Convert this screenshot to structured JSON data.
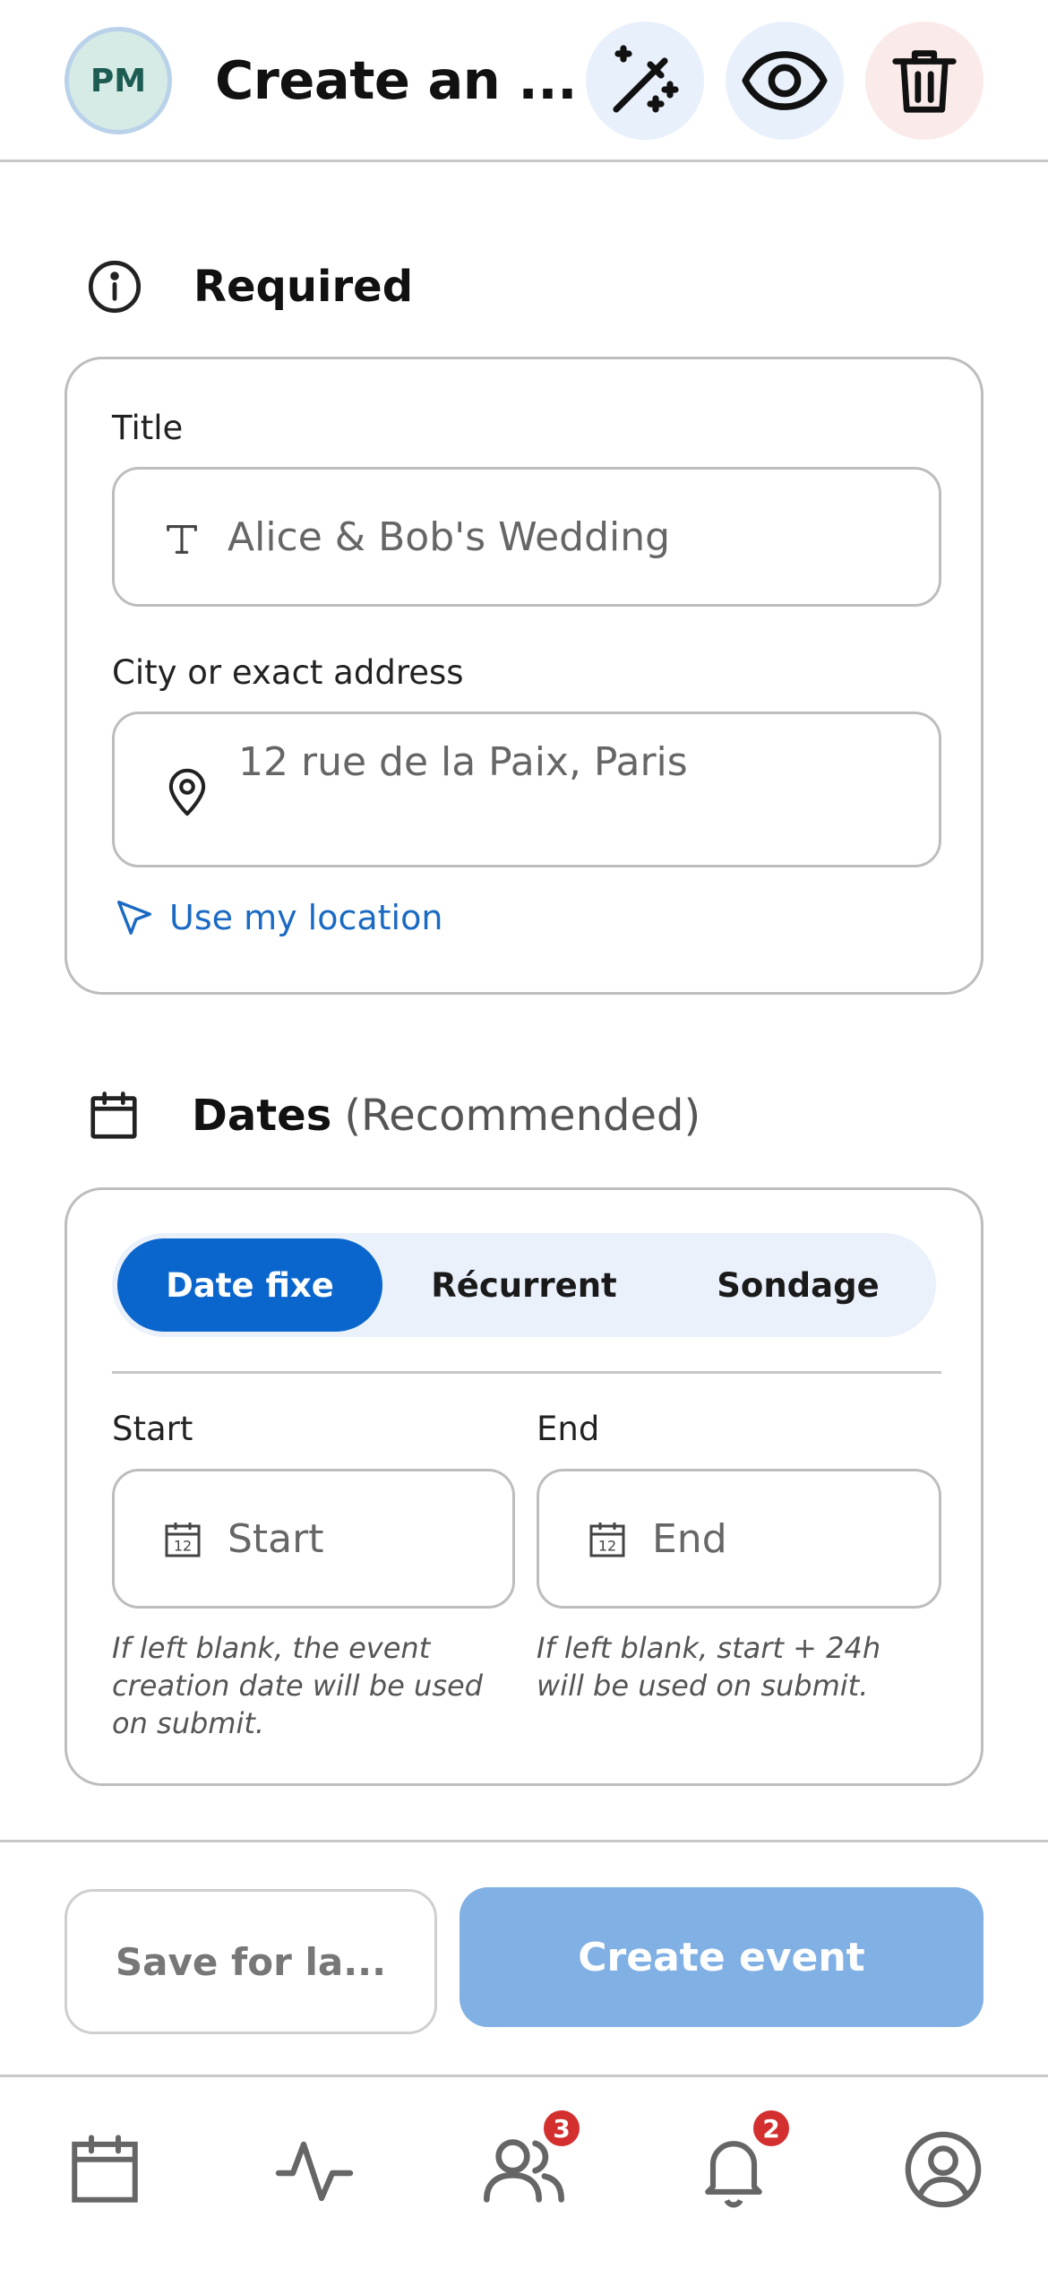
{
  "header": {
    "avatar_initials": "PM",
    "title": "Create an ...",
    "icons": [
      "magic-wand-icon",
      "eye-icon",
      "trash-icon"
    ]
  },
  "required": {
    "heading": "Required",
    "title_label": "Title",
    "title_placeholder": "Alice & Bob's Wedding",
    "address_label": "City or exact address",
    "address_placeholder": "12 rue de la Paix, Paris",
    "location_link": "Use my location"
  },
  "dates": {
    "heading": "Dates",
    "heading_note": "(Recommended)",
    "modes": [
      "Date fixe",
      "Récurrent",
      "Sondage"
    ],
    "active_mode": "Date fixe",
    "start_label": "Start",
    "start_placeholder": "Start",
    "end_label": "End",
    "end_placeholder": "End",
    "calendar_icon_day": "12",
    "start_hint": "If left blank, the event creation date will be used on submit.",
    "end_hint": "If left blank, start + 24h will be used on submit."
  },
  "actions": {
    "save_label": "Save for la...",
    "create_label": "Create event"
  },
  "nav": {
    "items": [
      "calendar-icon",
      "activity-icon",
      "people-icon",
      "bell-icon",
      "profile-icon"
    ],
    "people_badge": "3",
    "notifications_badge": "2"
  },
  "colors": {
    "accent": "#0a66cc",
    "primary_disabled": "#80b0e4",
    "badge": "#d32f2f",
    "link": "#1a6ac4"
  }
}
